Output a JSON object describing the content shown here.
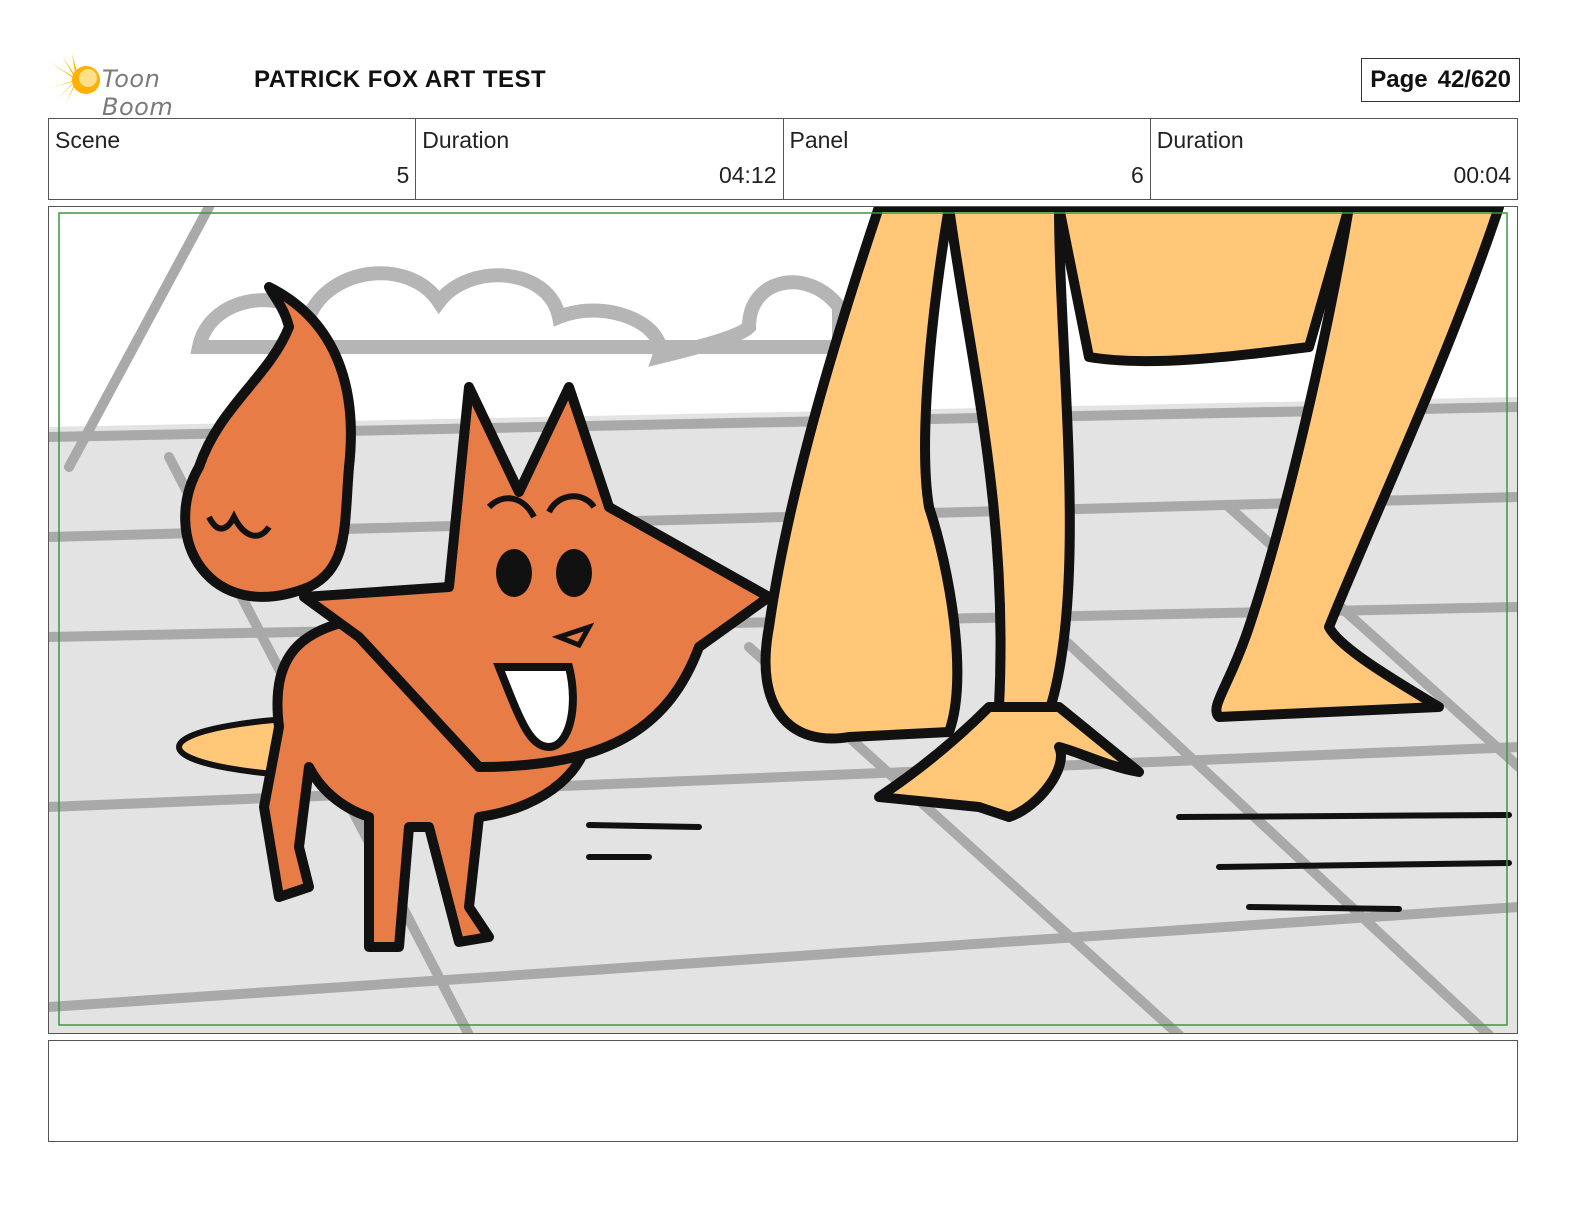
{
  "header": {
    "logo_text": "Toon Boom",
    "title": "PATRICK FOX ART TEST",
    "page_label": "Page",
    "page_value": "42/620"
  },
  "info": {
    "scene_label": "Scene",
    "scene_value": "5",
    "scene_duration_label": "Duration",
    "scene_duration_value": "04:12",
    "panel_label": "Panel",
    "panel_value": "6",
    "panel_duration_label": "Duration",
    "panel_duration_value": "00:04"
  },
  "colors": {
    "fox": "#e87c47",
    "skin": "#ffc777",
    "ground": "#e3e3e3",
    "lines": "#a9a9a9",
    "safe_frame": "#3a9a3a"
  },
  "notes": {
    "text": ""
  }
}
